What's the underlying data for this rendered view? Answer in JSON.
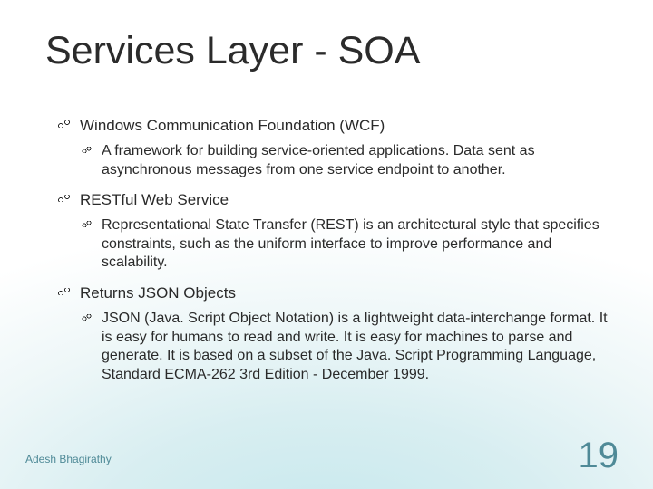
{
  "title": "Services Layer - SOA",
  "bullets": {
    "b1": "Windows Communication Foundation (WCF)",
    "b1a": "A framework for building service-oriented applications. Data sent as asynchronous messages from one service endpoint to another.",
    "b2": "RESTful Web Service",
    "b2a": "Representational State Transfer (REST) is an architectural style that specifies constraints, such as the uniform interface to improve performance and scalability.",
    "b3": "Returns JSON Objects",
    "b3a": "JSON (Java. Script Object Notation) is a lightweight data-interchange format. It is easy for humans to read and write. It is easy for machines to parse and generate. It is based on a subset of the Java. Script Programming Language, Standard ECMA-262 3rd Edition - December 1999."
  },
  "footer": {
    "author": "Adesh Bhagirathy",
    "page": "19"
  }
}
